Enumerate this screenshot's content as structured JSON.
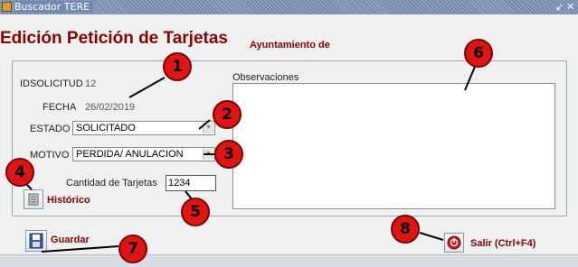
{
  "window": {
    "title": "Buscador TERE",
    "minimize": "↙",
    "close": "✕"
  },
  "header": {
    "page_title": "Edición Petición de Tarjetas",
    "municipality": "Ayuntamiento de"
  },
  "form": {
    "idsolicitud_label": "IDSOLICITUD",
    "idsolicitud_value": "12",
    "fecha_label": "FECHA",
    "fecha_value": "26/02/2019",
    "estado_label": "ESTADO",
    "estado_value": "SOLICITADO",
    "motivo_label": "MOTIVO",
    "motivo_value": "PERDIDA/ ANULACION",
    "cantidad_label": "Cantidad de Tarjetas",
    "cantidad_value": "1234",
    "observaciones_label": "Observaciones"
  },
  "buttons": {
    "historico": "Histórico",
    "guardar": "Guardar",
    "salir": "Salir (Ctrl+F4)"
  },
  "annotations": [
    "1",
    "2",
    "3",
    "4",
    "5",
    "6",
    "7",
    "8"
  ],
  "colors": {
    "title_red": "#8b0000",
    "badge_red": "#e11414"
  }
}
